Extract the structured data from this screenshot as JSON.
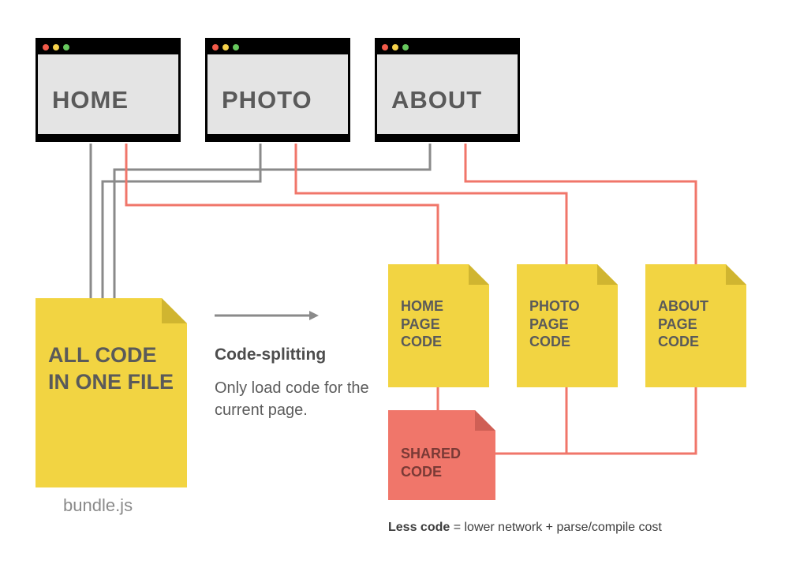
{
  "browsers": {
    "home": {
      "label": "HOME"
    },
    "photo": {
      "label": "PHOTO"
    },
    "about": {
      "label": "ABOUT"
    }
  },
  "files": {
    "bundle": {
      "text": "ALL CODE IN ONE FILE"
    },
    "home": {
      "text": "HOME PAGE CODE"
    },
    "photo": {
      "text": "PHOTO PAGE CODE"
    },
    "about": {
      "text": "ABOUT PAGE CODE"
    },
    "shared": {
      "text": "SHARED CODE"
    }
  },
  "caption": {
    "title": "Code-splitting",
    "sub": "Only load code for the current page."
  },
  "bundle_label": "bundle.js",
  "footnote_bold": "Less code",
  "footnote_rest": " = lower network + parse/compile cost",
  "colors": {
    "gray_line": "#8a8a8a",
    "red_line": "#f0766a"
  }
}
